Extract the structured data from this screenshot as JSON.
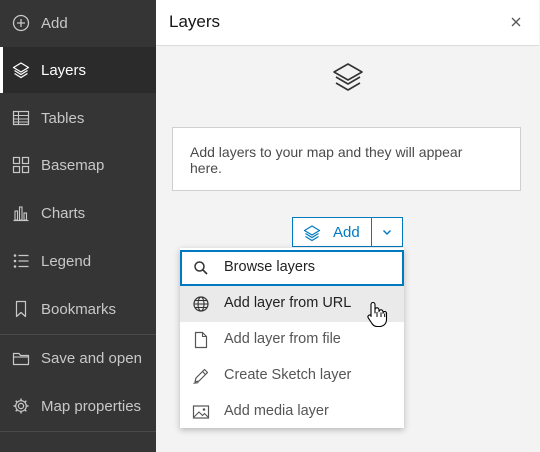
{
  "sidebar": {
    "items": [
      {
        "label": "Add",
        "icon": "plus-circle-icon"
      },
      {
        "label": "Layers",
        "icon": "layers-icon",
        "active": true
      },
      {
        "label": "Tables",
        "icon": "table-icon"
      },
      {
        "label": "Basemap",
        "icon": "basemap-icon"
      },
      {
        "label": "Charts",
        "icon": "charts-icon"
      },
      {
        "label": "Legend",
        "icon": "legend-icon"
      },
      {
        "label": "Bookmarks",
        "icon": "bookmark-icon"
      },
      {
        "label": "Save and open",
        "icon": "folder-icon"
      },
      {
        "label": "Map properties",
        "icon": "gear-icon"
      }
    ]
  },
  "panel": {
    "title": "Layers",
    "empty_message": "Add layers to your map and they will appear here.",
    "add_button_label": "Add"
  },
  "dropdown": {
    "items": [
      {
        "label": "Browse layers",
        "icon": "search-icon",
        "state": "focused"
      },
      {
        "label": "Add layer from URL",
        "icon": "globe-icon",
        "state": "hover"
      },
      {
        "label": "Add layer from file",
        "icon": "file-icon"
      },
      {
        "label": "Create Sketch layer",
        "icon": "pencil-icon"
      },
      {
        "label": "Add media layer",
        "icon": "image-icon"
      }
    ]
  },
  "colors": {
    "accent": "#0079c1",
    "sidebar_bg": "#353535",
    "panel_bg": "#f3f3f3"
  }
}
